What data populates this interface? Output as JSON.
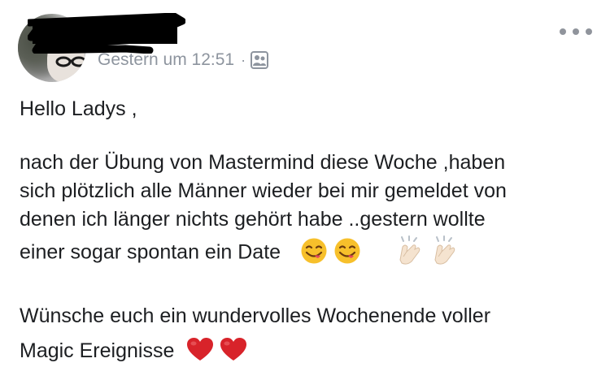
{
  "post": {
    "author": {
      "name_redacted": true
    },
    "timestamp": "Gestern um 12:51",
    "separator": "·",
    "audience_icon": "friends-icon",
    "more_icon": "more-options-icon",
    "body": {
      "greeting": "Hello Ladys ,",
      "paragraph2": {
        "line1": "nach der Übung von Mastermind diese Woche ,haben",
        "line2": "sich plötzlich alle Männer wieder bei mir gemeldet von",
        "line3": "denen ich länger nichts gehört habe ..gestern wollte",
        "line4": "einer sogar spontan ein Date"
      },
      "paragraph3": {
        "line1": "Wünsche euch ein wundervolles Wochenende voller",
        "line2": "Magic Ereignisse"
      }
    },
    "emojis": {
      "line4": [
        "face-savoring-food-emoji",
        "face-savoring-food-emoji",
        "clapping-hands-emoji",
        "clapping-hands-emoji"
      ],
      "last": [
        "red-heart-emoji",
        "red-heart-emoji"
      ]
    },
    "colors": {
      "text": "#1c1e21",
      "meta": "#8d949e",
      "heart": "#d8232a",
      "emoji_face": "#f7c02b"
    }
  }
}
